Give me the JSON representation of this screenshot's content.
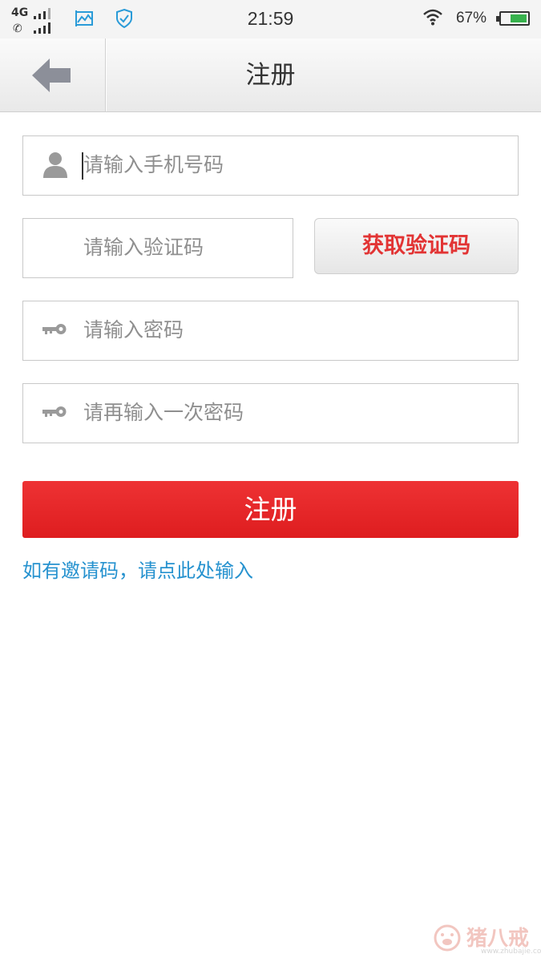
{
  "status_bar": {
    "network": "4G",
    "time": "21:59",
    "battery_percent": "67%",
    "battery_level": 0.67,
    "icons": [
      "signal-icon",
      "phone-icon",
      "screenshot-icon",
      "shield-check-icon",
      "wifi-icon",
      "battery-icon"
    ]
  },
  "header": {
    "title": "注册",
    "back_icon": "back-arrow-icon"
  },
  "form": {
    "phone_placeholder": "请输入手机号码",
    "code_placeholder": "请输入验证码",
    "get_code_label": "获取验证码",
    "password_placeholder": "请输入密码",
    "password_confirm_placeholder": "请再输入一次密码",
    "submit_label": "注册",
    "invite_link": "如有邀请码，请点此处输入"
  },
  "colors": {
    "accent_red": "#e42224",
    "get_code_text": "#e23434",
    "link_blue": "#2692cf",
    "battery_green": "#37b24d"
  },
  "watermark": {
    "brand": "猪八戒",
    "url": "www.zhubajie.com"
  }
}
